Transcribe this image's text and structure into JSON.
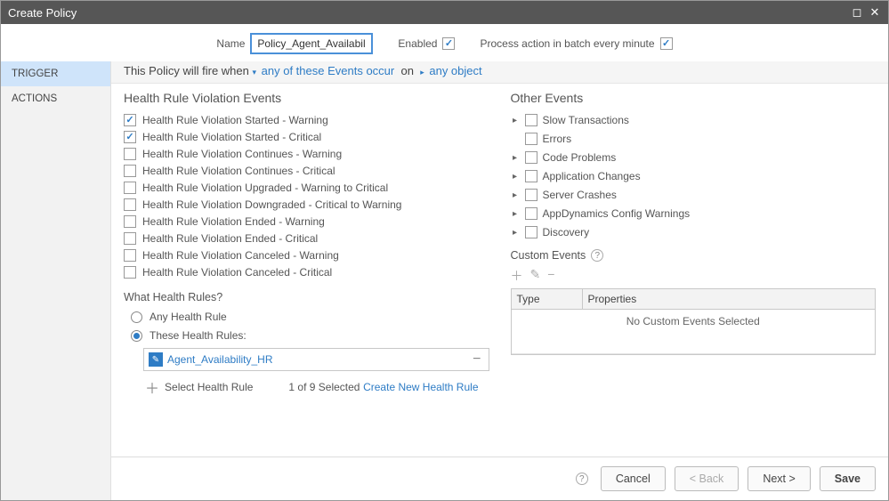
{
  "title": "Create Policy",
  "top": {
    "name_label": "Name",
    "name_value": "Policy_Agent_Availability",
    "enabled_label": "Enabled",
    "batch_label": "Process action in batch every minute"
  },
  "nav": {
    "trigger": "TRIGGER",
    "actions": "ACTIONS"
  },
  "fire": {
    "prefix": "This Policy will fire when",
    "events_mode": "any of these Events occur",
    "on": "on",
    "object_mode": "any object"
  },
  "hrve": {
    "title": "Health Rule Violation Events",
    "items": [
      {
        "label": "Health Rule Violation Started - Warning",
        "checked": true
      },
      {
        "label": "Health Rule Violation Started - Critical",
        "checked": true
      },
      {
        "label": "Health Rule Violation Continues - Warning",
        "checked": false
      },
      {
        "label": "Health Rule Violation Continues - Critical",
        "checked": false
      },
      {
        "label": "Health Rule Violation Upgraded - Warning to Critical",
        "checked": false
      },
      {
        "label": "Health Rule Violation Downgraded - Critical to Warning",
        "checked": false
      },
      {
        "label": "Health Rule Violation Ended - Warning",
        "checked": false
      },
      {
        "label": "Health Rule Violation Ended - Critical",
        "checked": false
      },
      {
        "label": "Health Rule Violation Canceled - Warning",
        "checked": false
      },
      {
        "label": "Health Rule Violation Canceled - Critical",
        "checked": false
      }
    ],
    "what_rules": "What Health Rules?",
    "opt_any": "Any Health Rule",
    "opt_these": "These Health Rules:",
    "selected_rule": "Agent_Availability_HR",
    "select_hr": "Select Health Rule",
    "count_text": "1 of 9 Selected",
    "create_link": "Create New Health Rule"
  },
  "other": {
    "title": "Other Events",
    "items": [
      {
        "label": "Slow Transactions",
        "expandable": true
      },
      {
        "label": "Errors",
        "expandable": false
      },
      {
        "label": "Code Problems",
        "expandable": true
      },
      {
        "label": "Application Changes",
        "expandable": true
      },
      {
        "label": "Server Crashes",
        "expandable": true
      },
      {
        "label": "AppDynamics Config Warnings",
        "expandable": true
      },
      {
        "label": "Discovery",
        "expandable": true
      }
    ],
    "custom_label": "Custom Events",
    "th_type": "Type",
    "th_props": "Properties",
    "empty": "No Custom Events Selected"
  },
  "footer": {
    "cancel": "Cancel",
    "back": "< Back",
    "next": "Next >",
    "save": "Save"
  }
}
